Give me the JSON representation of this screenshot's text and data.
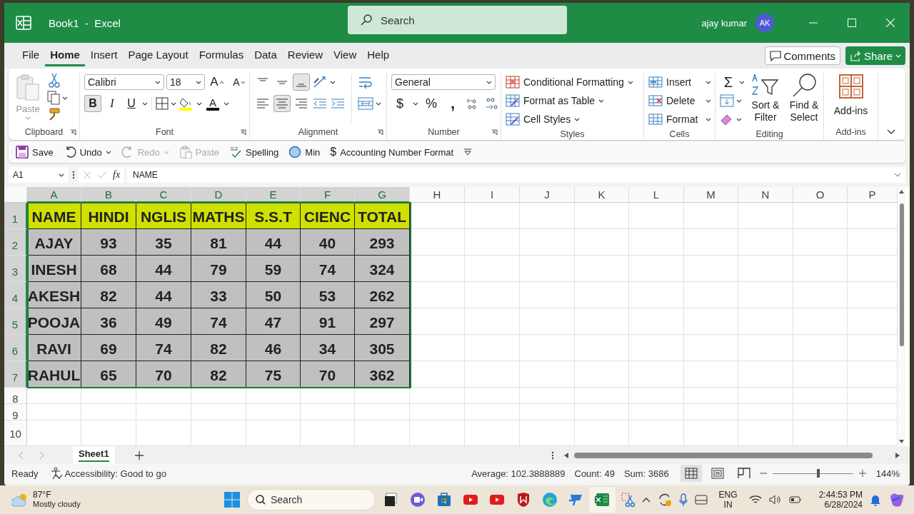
{
  "window": {
    "title": "Book1  -  Excel",
    "search_placeholder": "Search",
    "user_name": "ajay kumar",
    "user_initials": "AK"
  },
  "menu_tabs": [
    {
      "label": "File",
      "selected": false
    },
    {
      "label": "Home",
      "selected": true
    },
    {
      "label": "Insert",
      "selected": false
    },
    {
      "label": "Page Layout",
      "selected": false
    },
    {
      "label": "Formulas",
      "selected": false
    },
    {
      "label": "Data",
      "selected": false
    },
    {
      "label": "Review",
      "selected": false
    },
    {
      "label": "View",
      "selected": false
    },
    {
      "label": "Help",
      "selected": false
    }
  ],
  "comments_button": "Comments",
  "share_button": "Share",
  "ribbon": {
    "clipboard": {
      "label": "Clipboard",
      "paste": "Paste",
      "paste_disabled": true
    },
    "font": {
      "label": "Font",
      "font_name": "Calibri",
      "font_size": "18",
      "grow_font": "A",
      "shrink_font": "A",
      "font_color": "A",
      "styles": [
        {
          "glyph": "B",
          "kind": "bold",
          "on": true
        },
        {
          "glyph": "I",
          "kind": "italic",
          "on": false
        },
        {
          "glyph": "U",
          "kind": "underline",
          "on": false
        }
      ]
    },
    "alignment": {
      "label": "Alignment",
      "vertical": [
        {
          "kind": "top",
          "selected": false
        },
        {
          "kind": "middle",
          "selected": false
        },
        {
          "kind": "bottom",
          "selected": true
        }
      ],
      "horizontal": [
        {
          "kind": "left",
          "selected": false
        },
        {
          "kind": "center",
          "selected": true
        },
        {
          "kind": "right",
          "selected": false
        }
      ]
    },
    "number": {
      "label": "Number",
      "format": "General",
      "currency": "$",
      "percent": "%",
      "comma": ","
    },
    "styles": {
      "label": "Styles",
      "items": [
        "Conditional Formatting",
        "Format as Table",
        "Cell Styles"
      ]
    },
    "cells": {
      "label": "Cells",
      "items": [
        "Insert",
        "Delete",
        "Format"
      ]
    },
    "editing": {
      "label": "Editing",
      "autosum": "Σ",
      "sort_filter": "Sort & Filter",
      "find_select": "Find & Select"
    },
    "addins": {
      "label": "Add-ins",
      "button": "Add-ins"
    }
  },
  "quick_access": [
    {
      "label": "Save",
      "kind": "save",
      "disabled": false
    },
    {
      "label": "Undo",
      "kind": "undo",
      "disabled": false
    },
    {
      "label": "Redo",
      "kind": "redo",
      "disabled": true
    },
    {
      "label": "Paste",
      "kind": "paste",
      "disabled": true
    },
    {
      "label": "Spelling",
      "kind": "spelling",
      "disabled": false
    },
    {
      "label": "Min",
      "kind": "min",
      "disabled": false
    },
    {
      "label": "Accounting Number Format",
      "kind": "accounting",
      "glyph": "$",
      "disabled": false
    }
  ],
  "formula_bar": {
    "name_box": "A1",
    "fx": "fx",
    "formula": "NAME"
  },
  "sheet": {
    "columns": [
      {
        "label": "A",
        "selected": true
      },
      {
        "label": "B",
        "selected": true
      },
      {
        "label": "C",
        "selected": true
      },
      {
        "label": "D",
        "selected": true
      },
      {
        "label": "E",
        "selected": true
      },
      {
        "label": "F",
        "selected": true
      },
      {
        "label": "G",
        "selected": true
      },
      {
        "label": "H",
        "selected": false
      },
      {
        "label": "I",
        "selected": false
      },
      {
        "label": "J",
        "selected": false
      },
      {
        "label": "K",
        "selected": false
      },
      {
        "label": "L",
        "selected": false
      },
      {
        "label": "M",
        "selected": false
      },
      {
        "label": "N",
        "selected": false
      },
      {
        "label": "O",
        "selected": false
      },
      {
        "label": "P",
        "selected": false
      }
    ],
    "rows": [
      {
        "label": "1",
        "selected": true,
        "color": "#d0e000",
        "cells": [
          "NAME",
          "HINDI",
          "NGLIS",
          "MATHS",
          "S.S.T",
          "CIENC",
          "TOTAL"
        ]
      },
      {
        "label": "2",
        "selected": true,
        "color": "#c0c0c0",
        "cells": [
          "AJAY",
          "93",
          "35",
          "81",
          "44",
          "40",
          "293"
        ]
      },
      {
        "label": "3",
        "selected": true,
        "color": "#c0c0c0",
        "cells": [
          "INESH",
          "68",
          "44",
          "79",
          "59",
          "74",
          "324"
        ]
      },
      {
        "label": "4",
        "selected": true,
        "color": "#c0c0c0",
        "cells": [
          "AKESH",
          "82",
          "44",
          "33",
          "50",
          "53",
          "262"
        ]
      },
      {
        "label": "5",
        "selected": true,
        "color": "#c0c0c0",
        "cells": [
          "POOJA",
          "36",
          "49",
          "74",
          "47",
          "91",
          "297"
        ]
      },
      {
        "label": "6",
        "selected": true,
        "color": "#c0c0c0",
        "cells": [
          "RAVI",
          "69",
          "74",
          "82",
          "46",
          "34",
          "305"
        ]
      },
      {
        "label": "7",
        "selected": true,
        "color": "#c0c0c0",
        "cells": [
          "RAHUL",
          "65",
          "70",
          "82",
          "75",
          "70",
          "362"
        ]
      },
      {
        "label": "8",
        "selected": false
      },
      {
        "label": "9",
        "selected": false
      },
      {
        "label": "10",
        "selected": false
      }
    ]
  },
  "sheet_tabs": [
    {
      "label": "Sheet1",
      "selected": true
    }
  ],
  "status_bar": {
    "mode": "Ready",
    "accessibility": "Accessibility: Good to go",
    "average": "Average: 102.3888889",
    "count": "Count: 49",
    "sum": "Sum: 3686",
    "views": [
      {
        "kind": "normal",
        "selected": true
      },
      {
        "kind": "page_layout",
        "selected": false
      },
      {
        "kind": "page_break",
        "selected": false
      }
    ],
    "zoom": {
      "level": 0.57,
      "reading": "144%"
    }
  },
  "taskbar": {
    "temperature": "87°F",
    "weather": "Mostly cloudy",
    "search_placeholder": "Search",
    "apps": [
      {
        "kind": "task_view",
        "active": false
      },
      {
        "kind": "chat",
        "active": false
      },
      {
        "kind": "store",
        "active": false
      },
      {
        "kind": "video",
        "active": false
      },
      {
        "kind": "video",
        "active": false
      },
      {
        "kind": "shield",
        "active": false
      },
      {
        "kind": "browser",
        "active": false
      },
      {
        "kind": "remote",
        "active": false
      },
      {
        "kind": "excel",
        "active": true
      },
      {
        "kind": "snipping",
        "active": false
      }
    ],
    "language": "ENG",
    "region": "IN",
    "time": "2:44:53 PM",
    "date": "6/28/2024"
  }
}
